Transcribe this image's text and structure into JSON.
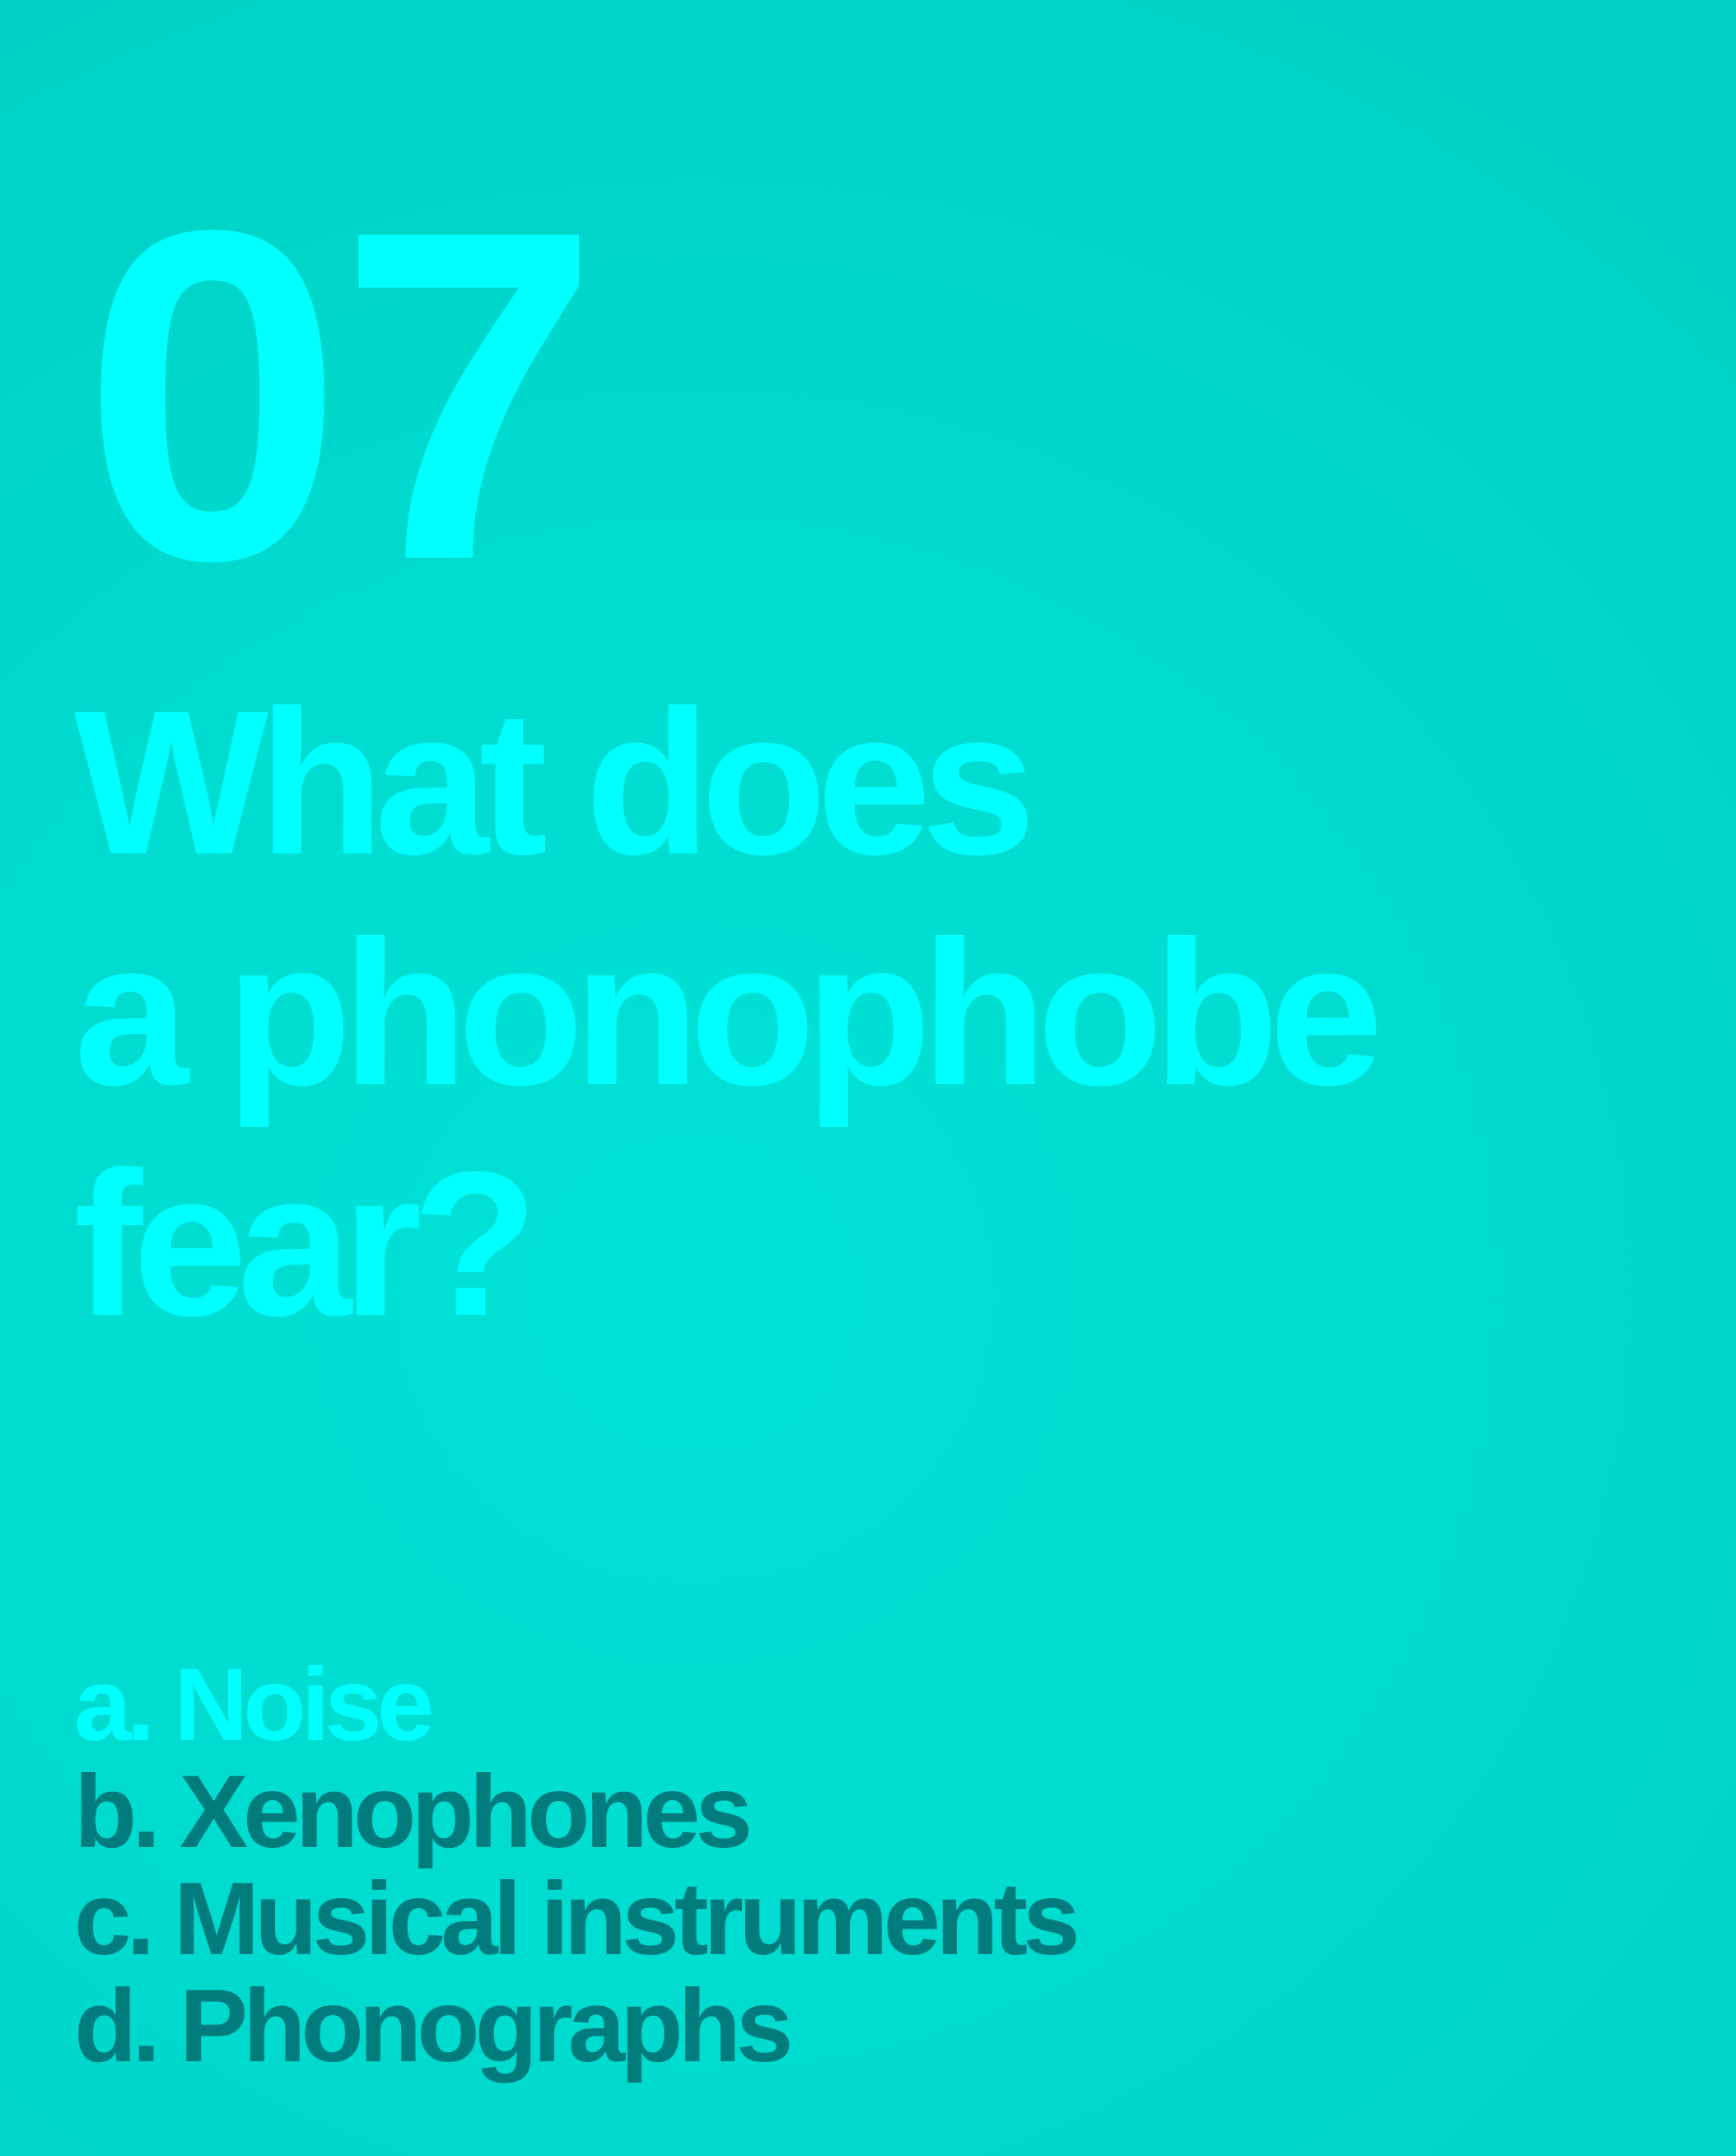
{
  "question_number": "07",
  "question_lines": [
    "What does",
    "a phonophobe",
    "fear?"
  ],
  "answers": [
    {
      "label": "a. Noise",
      "color": "#00ffff"
    },
    {
      "label": "b. Xenophones",
      "color": "#007c7c"
    },
    {
      "label": "c. Musical instruments",
      "color": "#007c7c"
    },
    {
      "label": "d. Phonographs",
      "color": "#007c7c"
    }
  ],
  "colors": {
    "accent": "#00ffff",
    "dark": "#007c7c",
    "background": "#00dbcf"
  }
}
